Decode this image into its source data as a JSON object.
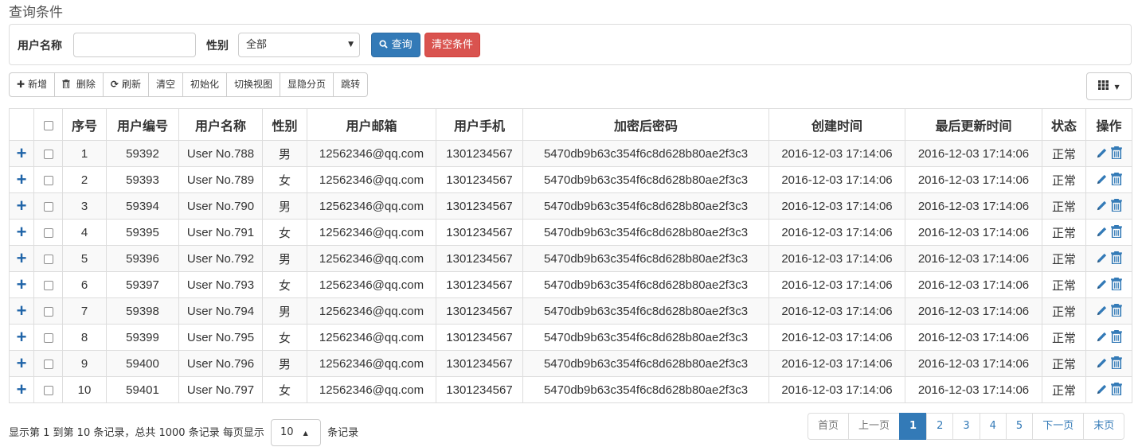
{
  "query": {
    "title": "查询条件",
    "username_label": "用户名称",
    "username_value": "",
    "gender_label": "性别",
    "gender_selected": "全部",
    "search_label": "查询",
    "clear_label": "清空条件"
  },
  "toolbar": {
    "add": "新增",
    "delete": "删除",
    "refresh": "刷新",
    "clear": "清空",
    "init": "初始化",
    "switch_view": "切换视图",
    "toggle_paging": "显隐分页",
    "jump": "跳转"
  },
  "columns": [
    "序号",
    "用户编号",
    "用户名称",
    "性别",
    "用户邮箱",
    "用户手机",
    "加密后密码",
    "创建时间",
    "最后更新时间",
    "状态",
    "操作"
  ],
  "rows": [
    {
      "no": "1",
      "id": "59392",
      "name": "User No.788",
      "gender": "男",
      "email": "12562346@qq.com",
      "phone": "1301234567",
      "pwd": "5470db9b63c354f6c8d628b80ae2f3c3",
      "created": "2016-12-03 17:14:06",
      "updated": "2016-12-03 17:14:06",
      "status": "正常"
    },
    {
      "no": "2",
      "id": "59393",
      "name": "User No.789",
      "gender": "女",
      "email": "12562346@qq.com",
      "phone": "1301234567",
      "pwd": "5470db9b63c354f6c8d628b80ae2f3c3",
      "created": "2016-12-03 17:14:06",
      "updated": "2016-12-03 17:14:06",
      "status": "正常"
    },
    {
      "no": "3",
      "id": "59394",
      "name": "User No.790",
      "gender": "男",
      "email": "12562346@qq.com",
      "phone": "1301234567",
      "pwd": "5470db9b63c354f6c8d628b80ae2f3c3",
      "created": "2016-12-03 17:14:06",
      "updated": "2016-12-03 17:14:06",
      "status": "正常"
    },
    {
      "no": "4",
      "id": "59395",
      "name": "User No.791",
      "gender": "女",
      "email": "12562346@qq.com",
      "phone": "1301234567",
      "pwd": "5470db9b63c354f6c8d628b80ae2f3c3",
      "created": "2016-12-03 17:14:06",
      "updated": "2016-12-03 17:14:06",
      "status": "正常"
    },
    {
      "no": "5",
      "id": "59396",
      "name": "User No.792",
      "gender": "男",
      "email": "12562346@qq.com",
      "phone": "1301234567",
      "pwd": "5470db9b63c354f6c8d628b80ae2f3c3",
      "created": "2016-12-03 17:14:06",
      "updated": "2016-12-03 17:14:06",
      "status": "正常"
    },
    {
      "no": "6",
      "id": "59397",
      "name": "User No.793",
      "gender": "女",
      "email": "12562346@qq.com",
      "phone": "1301234567",
      "pwd": "5470db9b63c354f6c8d628b80ae2f3c3",
      "created": "2016-12-03 17:14:06",
      "updated": "2016-12-03 17:14:06",
      "status": "正常"
    },
    {
      "no": "7",
      "id": "59398",
      "name": "User No.794",
      "gender": "男",
      "email": "12562346@qq.com",
      "phone": "1301234567",
      "pwd": "5470db9b63c354f6c8d628b80ae2f3c3",
      "created": "2016-12-03 17:14:06",
      "updated": "2016-12-03 17:14:06",
      "status": "正常"
    },
    {
      "no": "8",
      "id": "59399",
      "name": "User No.795",
      "gender": "女",
      "email": "12562346@qq.com",
      "phone": "1301234567",
      "pwd": "5470db9b63c354f6c8d628b80ae2f3c3",
      "created": "2016-12-03 17:14:06",
      "updated": "2016-12-03 17:14:06",
      "status": "正常"
    },
    {
      "no": "9",
      "id": "59400",
      "name": "User No.796",
      "gender": "男",
      "email": "12562346@qq.com",
      "phone": "1301234567",
      "pwd": "5470db9b63c354f6c8d628b80ae2f3c3",
      "created": "2016-12-03 17:14:06",
      "updated": "2016-12-03 17:14:06",
      "status": "正常"
    },
    {
      "no": "10",
      "id": "59401",
      "name": "User No.797",
      "gender": "女",
      "email": "12562346@qq.com",
      "phone": "1301234567",
      "pwd": "5470db9b63c354f6c8d628b80ae2f3c3",
      "created": "2016-12-03 17:14:06",
      "updated": "2016-12-03 17:14:06",
      "status": "正常"
    }
  ],
  "footer": {
    "info_prefix": "显示第 1 到第 10 条记录，总共 1000 条记录 每页显示",
    "page_size": "10",
    "info_suffix": "条记录"
  },
  "pagination": [
    "首页",
    "上一页",
    "1",
    "2",
    "3",
    "4",
    "5",
    "下一页",
    "末页"
  ],
  "pagination_active": "1",
  "pagination_disabled": [
    "首页",
    "上一页"
  ],
  "colors": {
    "primary": "#337ab7",
    "danger": "#d9534f",
    "expand_icon": "#1f64a8"
  },
  "icons": [
    "search-icon",
    "plus-icon",
    "trash-icon",
    "refresh-icon",
    "grid-icon",
    "expand-plus-icon",
    "edit-icon"
  ]
}
